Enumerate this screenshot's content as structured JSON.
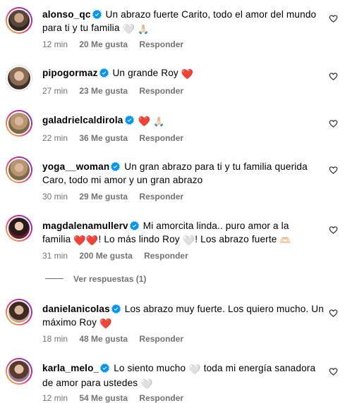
{
  "comments": [
    {
      "username": "alonso_qc",
      "text_lines": [
        "Un abrazo fuerte Carito, todo el amor del mundo",
        "para ti y tu familia"
      ],
      "emojis": [
        "🤍",
        "🙏🏻"
      ],
      "time": "12 min",
      "likes": "20 Me gusta",
      "reply": "Responder"
    },
    {
      "username": "pipogormaz",
      "text": "Un grande Roy",
      "emojis": [
        "❤️"
      ],
      "time": "27 min",
      "likes": "23 Me gusta",
      "reply": "Responder"
    },
    {
      "username": "galadrielcaldirola",
      "emojis": [
        "❤️",
        "🙏🏻"
      ],
      "time": "22 min",
      "likes": "36 Me gusta",
      "reply": "Responder"
    },
    {
      "username": "yoga__woman",
      "text_lines": [
        "Un gran abrazo para ti y tu familia querida",
        "Caro, todo mi amor y un gran abrazo"
      ],
      "time": "30 min",
      "likes": "29 Me gusta",
      "reply": "Responder"
    },
    {
      "username": "magdalenamullerv",
      "text_part1": "Mi amorcita linda.. puro amor a la",
      "text_part2": "familia",
      "text_part3": "! Lo más lindo Roy",
      "text_part4": "! Los abrazo fuerte",
      "emojis": [
        "❤️",
        "❤️",
        "🤍",
        "🫶🏻"
      ],
      "time": "31 min",
      "likes": "200 Me gusta",
      "reply": "Responder",
      "view_replies": "Ver respuestas (1)"
    },
    {
      "username": "danielanicolas",
      "text_line1": "Los abrazo muy fuerte. Los quiero mucho. Un",
      "text_line2": "máximo Roy",
      "emojis": [
        "❤️"
      ],
      "time": "18 min",
      "likes": "48 Me gusta",
      "reply": "Responder"
    },
    {
      "username": "karla_melo_",
      "text_part1": "Lo siento mucho",
      "text_part2": "toda mi energía sanadora",
      "text_part3": "de amor para ustedes",
      "emojis": [
        "🤍",
        "🤍"
      ],
      "time": "12 min",
      "likes": "54 Me gusta",
      "reply": "Responder"
    }
  ],
  "icons": {
    "verified": "verified-badge-icon",
    "like": "heart-outline-icon"
  },
  "colors": {
    "verified_blue": "#0095f6",
    "meta_gray": "#737373",
    "heart_red": "#e0243b"
  }
}
